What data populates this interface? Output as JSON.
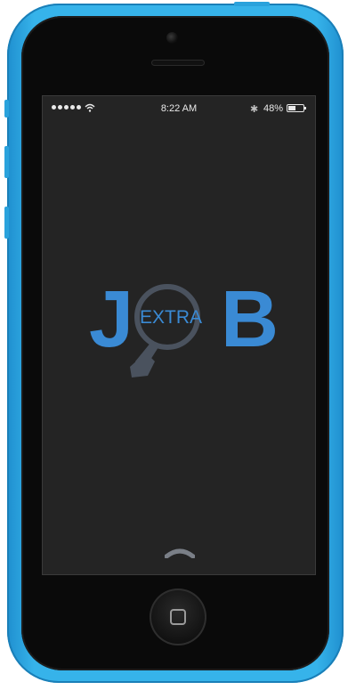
{
  "status_bar": {
    "time": "8:22 AM",
    "battery_percent": "48%",
    "battery_level": 0.48,
    "signal_dots": 5,
    "bluetooth_glyph": "✱",
    "wifi_icon": "wifi-icon"
  },
  "logo": {
    "letter_j": "J",
    "letter_b": "B",
    "inner_text": "EXTRA",
    "icon": "magnifier-tie-icon",
    "colors": {
      "brand_blue": "#3a8ad4",
      "lens_gray": "#4a525e"
    }
  },
  "gesture": {
    "icon": "chevron-up-icon"
  },
  "device": {
    "body_color": "#36b3ea",
    "screen_bg": "#242424"
  }
}
